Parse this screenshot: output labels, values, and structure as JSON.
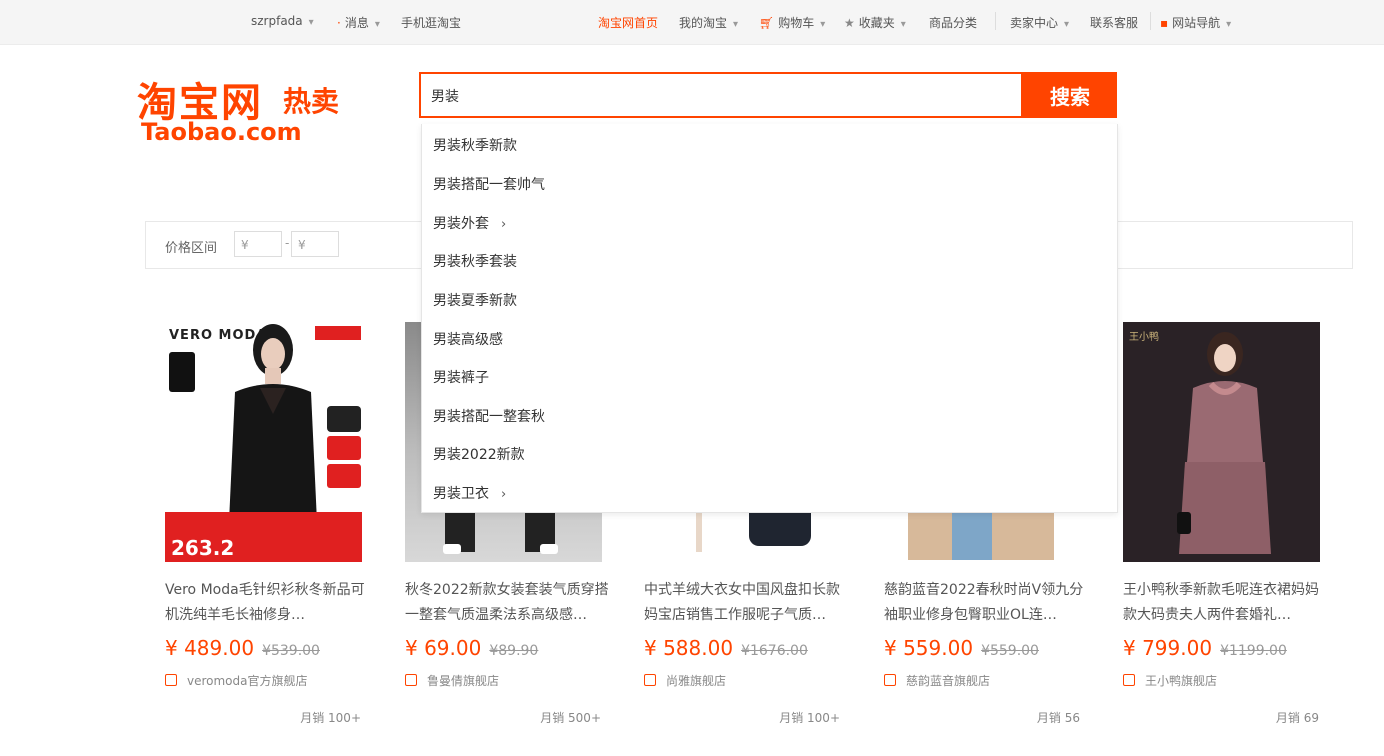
{
  "topnav": {
    "user": "szrpfada",
    "messages": "消息",
    "mobile": "手机逛淘宝",
    "home": "淘宝网首页",
    "my_taobao": "我的淘宝",
    "cart": "购物车",
    "favorites": "收藏夹",
    "categories": "商品分类",
    "seller_center": "卖家中心",
    "customer_service": "联系客服",
    "site_nav": "网站导航"
  },
  "logo": {
    "cn": "淘宝网",
    "hot": "热卖",
    "en": "Taobao.com"
  },
  "search": {
    "value": "男装",
    "button": "搜索"
  },
  "suggestions": [
    {
      "text": "男装秋季新款",
      "arrow": ""
    },
    {
      "text": "男装搭配一套帅气",
      "arrow": ""
    },
    {
      "text": "男装外套",
      "arrow": "›"
    },
    {
      "text": "男装秋季套装",
      "arrow": ""
    },
    {
      "text": "男装夏季新款",
      "arrow": ""
    },
    {
      "text": "男装高级感",
      "arrow": ""
    },
    {
      "text": "男装裤子",
      "arrow": ""
    },
    {
      "text": "男装搭配一整套秋",
      "arrow": ""
    },
    {
      "text": "男装2022新款",
      "arrow": ""
    },
    {
      "text": "男装卫衣",
      "arrow": "›"
    }
  ],
  "filter": {
    "label": "价格区间",
    "min_placeholder": "¥",
    "dash": "-",
    "max_placeholder": "¥"
  },
  "products": [
    {
      "title": "Vero Moda毛针织衫秋冬新品可机洗纯羊毛长袖修身…",
      "price": "¥ 489.00",
      "original_price": "¥539.00",
      "shop": "veromoda官方旗舰店",
      "sales": "月销 100+",
      "img_brand": "VERO MODA",
      "img_price": "263.2"
    },
    {
      "title": "秋冬2022新款女装套装气质穿搭一整套气质温柔法系高级感…",
      "price": "¥ 69.00",
      "original_price": "¥89.90",
      "shop": "鲁曼倩旗舰店",
      "sales": "月销 500+"
    },
    {
      "title": "中式羊绒大衣女中国风盘扣长款妈宝店销售工作服呢子气质…",
      "price": "¥ 588.00",
      "original_price": "¥1676.00",
      "shop": "尚雅旗舰店",
      "sales": "月销 100+"
    },
    {
      "title": "慈韵蓝音2022春秋时尚V领九分袖职业修身包臀职业OL连…",
      "price": "¥ 559.00",
      "original_price": "¥559.00",
      "shop": "慈韵蓝音旗舰店",
      "sales": "月销 56"
    },
    {
      "title": "王小鸭秋季新款毛呢连衣裙妈妈款大码贵夫人两件套婚礼…",
      "price": "¥ 799.00",
      "original_price": "¥1199.00",
      "shop": "王小鸭旗舰店",
      "sales": "月销 69",
      "img_brand": "王小鸭"
    }
  ]
}
